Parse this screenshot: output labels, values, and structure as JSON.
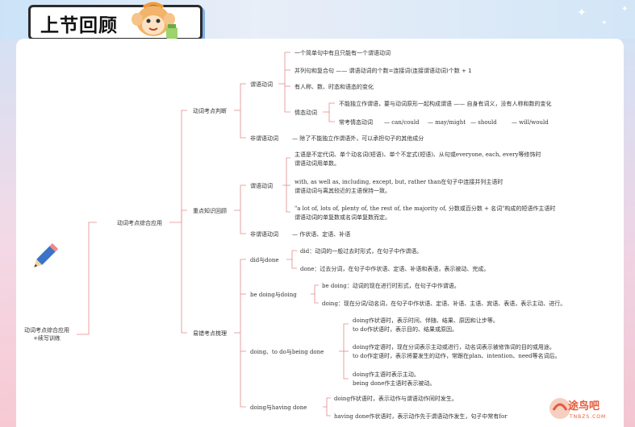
{
  "header": {
    "title": "上节回顾"
  },
  "watermark": {
    "name": "途鸟吧",
    "url": "TNBZS.COM"
  },
  "root": {
    "label": "动词考点综合应用\n+续写训练"
  },
  "level1": {
    "label": "动词考点综合应用"
  },
  "branches": {
    "judge": {
      "label": "动词考点判断",
      "predicate": {
        "label": "谓语动词",
        "items": [
          "一个简单句中有且只能有一个谓语动词",
          "并列句和复合句 —— 谓语动词的个数=连接词(连接谓语动词)个数 + 1",
          "有人称、数、时态和语态的变化"
        ],
        "modal": {
          "label": "情态动词",
          "rule": "不能独立作谓语，要与动词原形一起构成谓语 —— 自身有词义，没有人称和数的变化",
          "common_label": "常考情态动词",
          "words": [
            "can/could",
            "may/might",
            "should",
            "will/would"
          ]
        }
      },
      "nonpredicate": {
        "label": "非谓语动词",
        "text": "除了不能独立作谓语外，可以承担句子的其他成分"
      }
    },
    "review": {
      "label": "重点知识回顾",
      "predicate": {
        "label": "谓语动词",
        "items": [
          [
            "主语是不定代词、单个动名词(短语)、单个不定式(短语)、从句或everyone, each, every等修饰时",
            "谓语动词用单数。"
          ],
          [
            "with, as well as, including, except, but, rather than在句子中连接并列主语时",
            "谓语动词与离其较近的主语保持一致。"
          ],
          [
            "\"a lot of, lots of, plenty of, the rest of, the majority of, 分数或百分数 + 名词\"构成的短语作主语时",
            "谓语动词的单复数或名词单复数而定。"
          ]
        ]
      },
      "nonpredicate": {
        "label": "非谓语动词",
        "text": "作状语、定语、补语"
      }
    },
    "confuse": {
      "label": "易错考点梳理",
      "did_done": {
        "label": "did与done",
        "items": [
          "did：动词的一般过去时形式，在句子中作谓语。",
          "done：过去分词，在句子中作状语、定语、补语和表语，表示被动、完成。"
        ]
      },
      "be_doing": {
        "label": "be doing与doing",
        "items": [
          "be doing：动词的现在进行时形式，在句子中作谓语。",
          "doing：现在分词/动名词，在句子中作状语、定语、补语、主语、宾语、表语，表示主动、进行。"
        ]
      },
      "doing_to_do": {
        "label": "doing、to do与being done",
        "groups": [
          [
            "doing作状语时，表示时间、伴随、结果、原因和让步等。",
            "to do作状语时，表示目的、结果或原因。"
          ],
          [
            "doing作定语时，现在分词表示主动或进行，动名词表示被修饰词的目的或用途。",
            "to do作定语时，表示将要发生的动作，常跟在plan、intention、need等名词后。"
          ],
          [
            "doing作主语时表示主动。",
            "being done作主语时表示被动。"
          ]
        ]
      },
      "having_done": {
        "label": "doing与having done",
        "items": [
          "doing作状语时，表示动作与谓语动作同时发生。",
          "having done作状语时，表示动作先于谓语动作发生，句子中常有for"
        ]
      }
    }
  },
  "colors": {
    "line": "#e28a8a",
    "text": "#333333",
    "title_border": "#2b2b2b",
    "accent": "#7fb2e5"
  }
}
